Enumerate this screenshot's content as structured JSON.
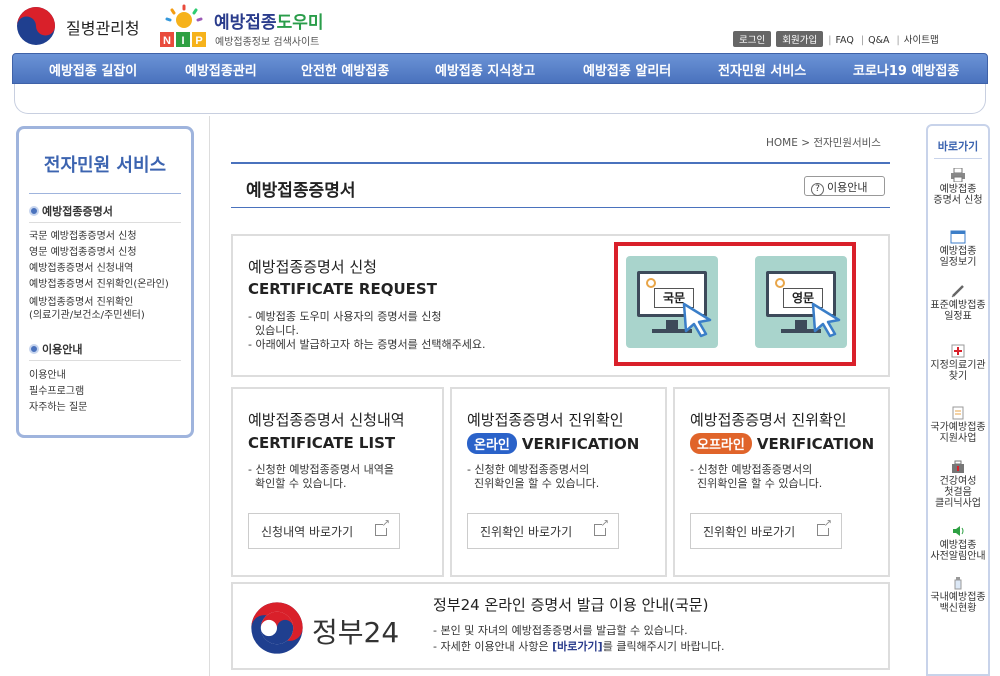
{
  "header": {
    "kdca_logo_text": "질병관리청",
    "nip_logo": {
      "badge": "NIP",
      "title_main": "예방접종",
      "title_accent": "도우미",
      "subtitle": "예방접종정보 검색사이트"
    },
    "util": {
      "login": "로그인",
      "join": "회원가입",
      "faq": "FAQ",
      "qna": "Q&A",
      "sitemap": "사이트맵"
    }
  },
  "nav": {
    "items": [
      "예방접종 길잡이",
      "예방접종관리",
      "안전한 예방접종",
      "예방접종 지식창고",
      "예방접종 알리터",
      "전자민원 서비스",
      "코로나19 예방접종"
    ]
  },
  "sidebar": {
    "title": "전자민원 서비스",
    "section1": "예방접종증명서",
    "links1": [
      "국문 예방접종증명서 신청",
      "영문 예방접종증명서 신청",
      "예방접종증명서 신청내역",
      "예방접종증명서 진위확인(온라인)",
      "예방접종증명서 진위확인",
      "(의료기관/보건소/주민센터)"
    ],
    "section2": "이용안내",
    "links2": [
      "이용안내",
      "필수프로그램",
      "자주하는 질문"
    ]
  },
  "breadcrumb": "HOME > 전자민원서비스",
  "page_title": "예방접종증명서",
  "guide_button": "이용안내",
  "request": {
    "title_ko": "예방접종증명서 신청",
    "title_en": "CERTIFICATE REQUEST",
    "desc": [
      "- 예방접종 도우미 사용자의 증명서를 신청",
      "  있습니다.",
      "- 아래에서 발급하고자 하는 증명서를 선택해주세요."
    ],
    "korean_label": "국문",
    "english_label": "영문"
  },
  "list_card": {
    "title_ko": "예방접종증명서 신청내역",
    "title_en": "CERTIFICATE LIST",
    "desc": [
      "- 신청한 예방접종증명서 내역을",
      "  확인할 수 있습니다."
    ],
    "button": "신청내역 바로가기"
  },
  "online_card": {
    "title_ko": "예방접종증명서 진위확인",
    "badge": "온라인",
    "title_en": "VERIFICATION",
    "desc": [
      "- 신청한 예방접종증명서의",
      "  진위확인을 할 수 있습니다."
    ],
    "button": "진위확인 바로가기",
    "badge_color": "#2a62c9"
  },
  "offline_card": {
    "title_ko": "예방접종증명서 진위확인",
    "badge": "오프라인",
    "title_en": "VERIFICATION",
    "desc": [
      "- 신청한 예방접종증명서의",
      "  진위확인을 할 수 있습니다."
    ],
    "button": "진위확인 바로가기",
    "badge_color": "#e0642a"
  },
  "gov24": {
    "logo_text": "정부24",
    "title": "정부24 온라인 증명서 발급 이용 안내(국문)",
    "line1": "- 본인 및 자녀의 예방접종증명서를 발급할 수 있습니다.",
    "line2_pre": "- 자세한 이용안내 사항은 ",
    "line2_link": "[바로가기]",
    "line2_post": "를 클릭해주시기 바랍니다."
  },
  "quickbar": {
    "title": "바로가기",
    "items": [
      {
        "label": "예방접종\n증명서 신청",
        "icon": "printer-icon"
      },
      {
        "label": "예방접종\n일정보기",
        "icon": "calendar-icon"
      },
      {
        "label": "표준예방접종\n일정표",
        "icon": "syringe-icon"
      },
      {
        "label": "지정의료기관\n찾기",
        "icon": "hospital-icon"
      },
      {
        "label": "국가예방접종\n지원사업",
        "icon": "document-icon"
      },
      {
        "label": "건강여성\n첫걸음\n클리닉사업",
        "icon": "kit-icon"
      },
      {
        "label": "예방접종\n사전알림안내",
        "icon": "speaker-icon"
      },
      {
        "label": "국내예방접종\n백신현황",
        "icon": "vial-icon"
      }
    ]
  },
  "colors": {
    "nav": "#4a72bd",
    "accent": "#3c64b0",
    "highlight": "#d9202a"
  }
}
